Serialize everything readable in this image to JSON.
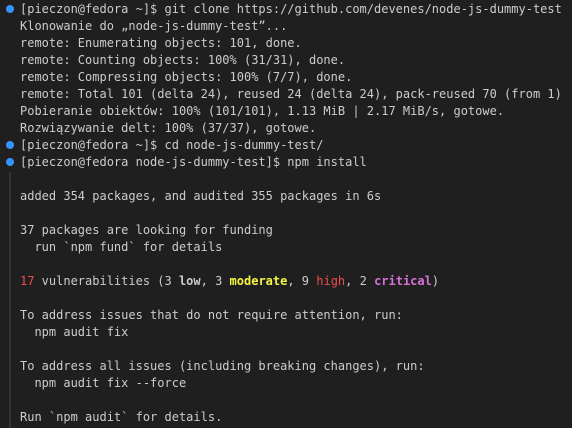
{
  "terminal": {
    "prompt_marker_color": "#3794ff",
    "lines": {
      "l1": "[pieczon@fedora ~]$ git clone https://github.com/devenes/node-js-dummy-test",
      "l2": "Klonowanie do „node-js-dummy-test”...",
      "l3": "remote: Enumerating objects: 101, done.",
      "l4": "remote: Counting objects: 100% (31/31), done.",
      "l5": "remote: Compressing objects: 100% (7/7), done.",
      "l6": "remote: Total 101 (delta 24), reused 24 (delta 24), pack-reused 70 (from 1)",
      "l7": "Pobieranie obiektów: 100% (101/101), 1.13 MiB | 2.17 MiB/s, gotowe.",
      "l8": "Rozwiązywanie delt: 100% (37/37), gotowe.",
      "l9": "[pieczon@fedora ~]$ cd node-js-dummy-test/",
      "l10": "[pieczon@fedora node-js-dummy-test]$ npm install",
      "l11": "added 354 packages, and audited 355 packages in 6s",
      "l12": "37 packages are looking for funding",
      "l13": "  run `npm fund` for details",
      "l15": "To address issues that do not require attention, run:",
      "l16": "  npm audit fix",
      "l17": "To address all issues (including breaking changes), run:",
      "l18": "  npm audit fix --force",
      "l19": "Run `npm audit` for details."
    },
    "vuln": {
      "count": "17",
      "text1": " vulnerabilities (3 ",
      "low": "low",
      "text2": ", 3 ",
      "moderate": "moderate",
      "text3": ", 9 ",
      "high": "high",
      "text4": ", 2 ",
      "critical": "critical",
      "text5": ")"
    }
  }
}
